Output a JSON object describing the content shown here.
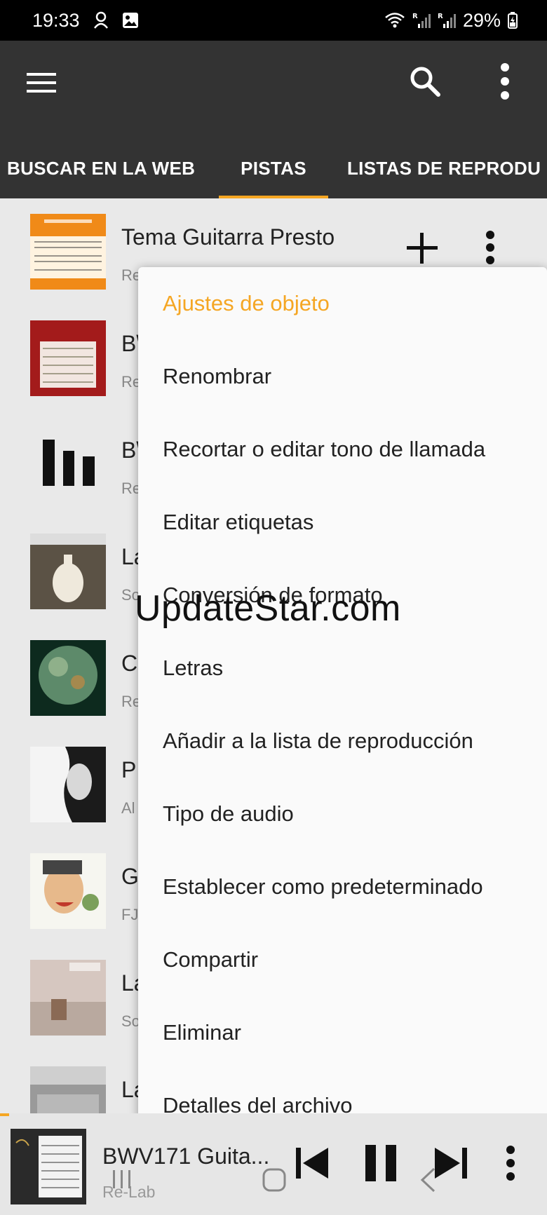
{
  "status_bar": {
    "time": "19:33",
    "battery": "29%",
    "icons": [
      "privacy-icon",
      "image-icon",
      "wifi-icon",
      "signal-r-icon",
      "signal-r-icon",
      "battery-charging-icon"
    ]
  },
  "app_bar": {
    "icons": [
      "menu-icon",
      "search-icon",
      "more-vert-icon"
    ]
  },
  "tabs": [
    {
      "label": "BUSCAR EN LA WEB"
    },
    {
      "label": "PISTAS",
      "active": true
    },
    {
      "label": "LISTAS DE REPRODU"
    }
  ],
  "tracks": [
    {
      "title": "Tema Guitarra Presto",
      "subtitle": "Re"
    },
    {
      "title": "B\\",
      "subtitle": "Re"
    },
    {
      "title": "B\\",
      "subtitle": "Re"
    },
    {
      "title": "La",
      "subtitle": "So"
    },
    {
      "title": "C",
      "subtitle": "Re"
    },
    {
      "title": "P",
      "subtitle": "Al"
    },
    {
      "title": "G",
      "subtitle": "FJ"
    },
    {
      "title": "La",
      "subtitle": "So"
    },
    {
      "title": "La",
      "subtitle": ""
    }
  ],
  "context_menu": {
    "header": "Ajustes de objeto",
    "items": [
      "Renombrar",
      "Recortar o editar tono de llamada",
      "Editar etiquetas",
      "Conversión de formato",
      "Letras",
      "Añadir a la lista de reproducción",
      "Tipo de audio",
      "Establecer como predeterminado",
      "Compartir",
      "Eliminar",
      "Detalles del archivo"
    ]
  },
  "watermark": "UpdateStar.com",
  "now_playing": {
    "title": "BWV171 Guita...",
    "artist": "Re-Lab",
    "progress": 0.017
  },
  "colors": {
    "accent": "#f5a623",
    "app_bar": "#333333",
    "background": "#e9e9e9",
    "menu_bg": "#fafafa"
  }
}
